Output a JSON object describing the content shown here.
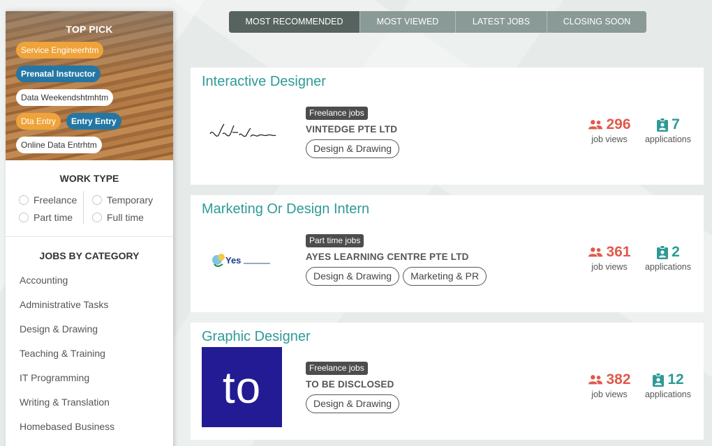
{
  "sidebar": {
    "top_pick": {
      "title": "TOP PICK",
      "pills": [
        {
          "label": "Service Engineerhtm",
          "style": "orange"
        },
        {
          "label": "Prenatal Instructor",
          "style": "blue"
        },
        {
          "label": "Data Weekendshtmhtm",
          "style": "white"
        },
        {
          "label": "Dta Entry",
          "style": "orange"
        },
        {
          "label": "Entry Entry",
          "style": "blue"
        },
        {
          "label": "Online Data Entrhtm",
          "style": "white"
        }
      ]
    },
    "work_type": {
      "title": "WORK TYPE",
      "options": [
        "Freelance",
        "Part time",
        "Temporary",
        "Full time"
      ]
    },
    "jobs_by_category": {
      "title": "JOBS BY CATEGORY",
      "items": [
        "Accounting",
        "Administrative Tasks",
        "Design & Drawing",
        "Teaching & Training",
        "IT Programming",
        "Writing & Translation",
        "Homebased Business"
      ]
    }
  },
  "tabs": [
    {
      "label": "MOST RECOMMENDED",
      "active": true
    },
    {
      "label": "MOST VIEWED",
      "active": false
    },
    {
      "label": "LATEST JOBS",
      "active": false
    },
    {
      "label": "CLOSING SOON",
      "active": false
    }
  ],
  "jobs": [
    {
      "title": "Interactive Designer",
      "job_type": "Freelance jobs",
      "company": "VINTEDGE PTE LTD",
      "tags": [
        "Design & Drawing"
      ],
      "views": "296",
      "views_label": "job views",
      "applications": "7",
      "applications_label": "applications",
      "logo": "signature"
    },
    {
      "title": "Marketing Or Design Intern",
      "job_type": "Part time jobs",
      "company": "AYES LEARNING CENTRE PTE LTD",
      "tags": [
        "Design & Drawing",
        "Marketing & PR"
      ],
      "views": "361",
      "views_label": "job views",
      "applications": "2",
      "applications_label": "applications",
      "logo": "yes",
      "logo_text": "Yes"
    },
    {
      "title": "Graphic Designer",
      "job_type": "Freelance jobs",
      "company": "TO BE DISCLOSED",
      "tags": [
        "Design & Drawing"
      ],
      "views": "382",
      "views_label": "job views",
      "applications": "12",
      "applications_label": "applications",
      "logo": "to",
      "logo_text": "to"
    }
  ],
  "colors": {
    "accent_teal": "#2e9a96",
    "views_red": "#e05a4a",
    "tab_active": "#56635f",
    "tab_inactive": "#8a9a96",
    "pill_orange": "#efa33a",
    "pill_blue": "#2477a4"
  },
  "icons": {
    "views": "people-icon",
    "applications": "clipboard-user-icon"
  }
}
